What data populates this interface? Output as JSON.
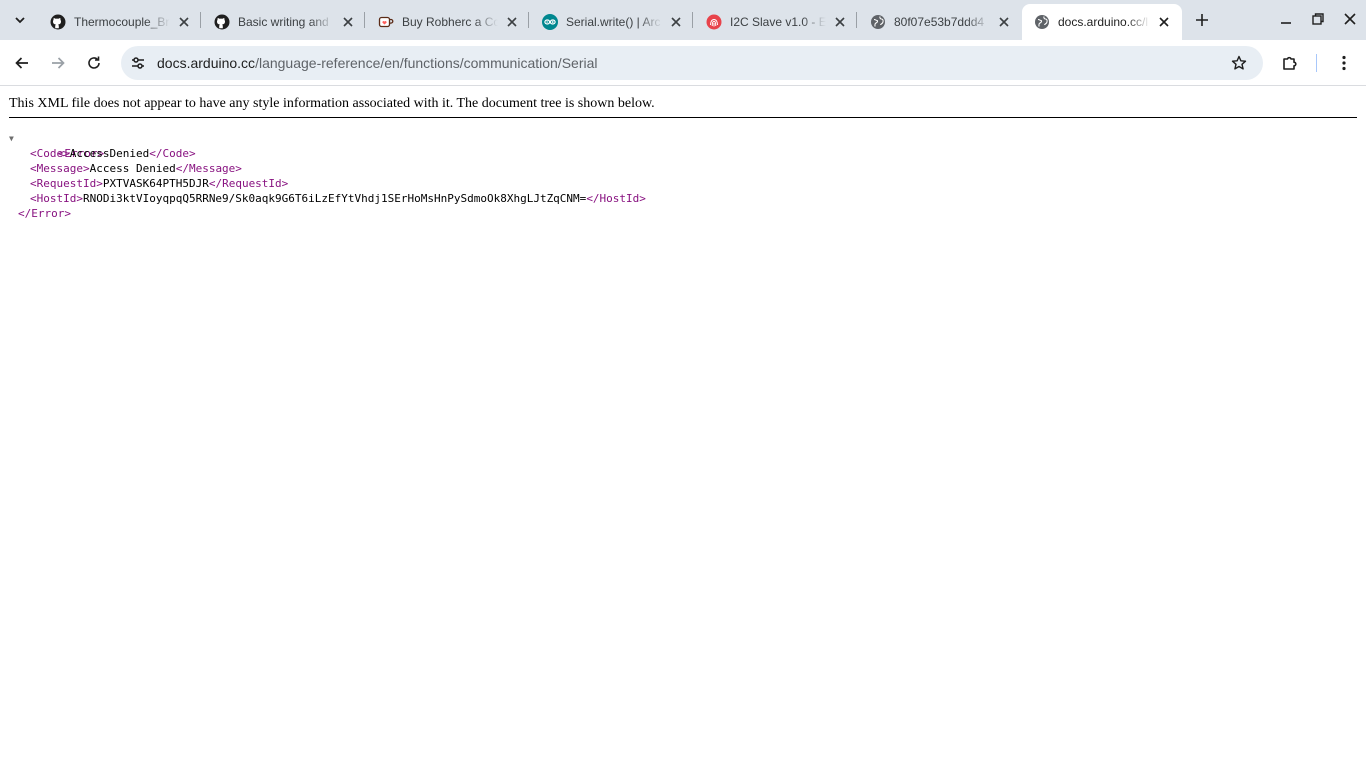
{
  "tabs": [
    {
      "title": "Thermocouple_Br",
      "favicon": "github-icon",
      "active": false
    },
    {
      "title": "Basic writing and",
      "favicon": "github-icon",
      "active": false
    },
    {
      "title": "Buy Robherc a Co",
      "favicon": "kofi-cup-icon",
      "active": false
    },
    {
      "title": "Serial.write() | Arc",
      "favicon": "arduino-icon",
      "active": false
    },
    {
      "title": "I2C Slave v1.0 - E",
      "favicon": "fingerprint-icon",
      "active": false
    },
    {
      "title": "80f07e53b7ddd4",
      "favicon": "globe-icon",
      "active": false
    },
    {
      "title": "docs.arduino.cc/l",
      "favicon": "globe-icon",
      "active": true
    }
  ],
  "address_bar": {
    "host": "docs.arduino.cc",
    "path": "/language-reference/en/functions/communication/Serial"
  },
  "page": {
    "info_text": "This XML file does not appear to have any style information associated with it. The document tree is shown below.",
    "xml": {
      "root_open": "<Error>",
      "root_close": "</Error>",
      "children": [
        {
          "open": "<Code>",
          "value": "AccessDenied",
          "close": "</Code>"
        },
        {
          "open": "<Message>",
          "value": "Access Denied",
          "close": "</Message>"
        },
        {
          "open": "<RequestId>",
          "value": "PXTVASK64PTH5DJR",
          "close": "</RequestId>"
        },
        {
          "open": "<HostId>",
          "value": "RNODi3ktVIoyqpqQ5RRNe9/Sk0aqk9G6T6iLzEfYtVhdj1SErHoMsHnPySdmoOk8XhgLJtZqCNM=",
          "close": "</HostId>"
        }
      ]
    }
  },
  "colors": {
    "tabstrip_bg": "#dde3ea",
    "omnibox_bg": "#e8eef4",
    "xml_tag": "#881280"
  }
}
